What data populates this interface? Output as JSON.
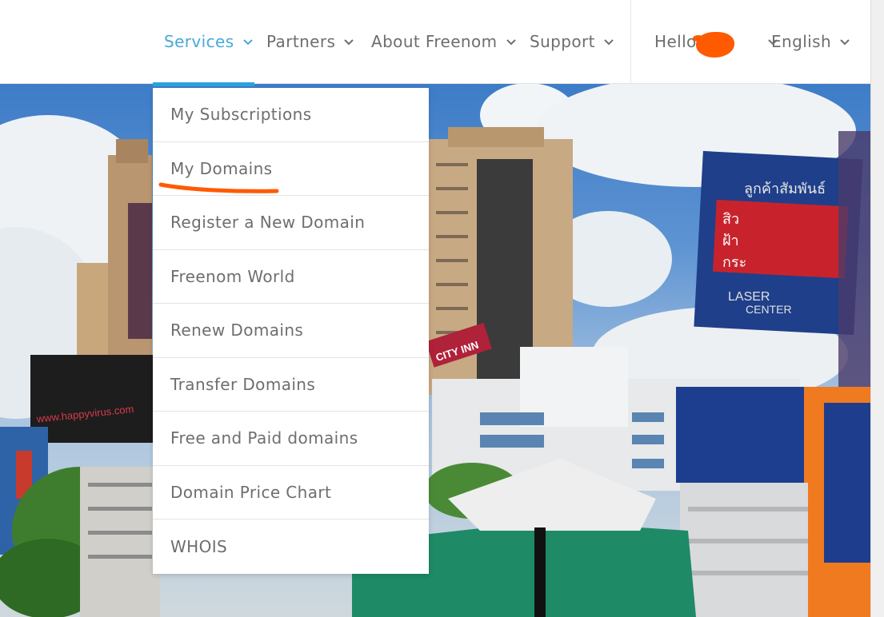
{
  "nav": {
    "services": "Services",
    "partners": "Partners",
    "about": "About Freenom",
    "support": "Support",
    "hello": "Hello",
    "language": "English"
  },
  "dropdown": {
    "items": [
      {
        "label": "My Subscriptions"
      },
      {
        "label": "My Domains"
      },
      {
        "label": "Register a New Domain"
      },
      {
        "label": "Freenom World"
      },
      {
        "label": "Renew Domains"
      },
      {
        "label": "Transfer Domains"
      },
      {
        "label": "Free and Paid domains"
      },
      {
        "label": "Domain Price Chart"
      },
      {
        "label": "WHOIS"
      }
    ]
  },
  "hero": {
    "billboard_thai_top": "ลูกค้าสัมพันธ์",
    "billboard_thai_1": "สิว",
    "billboard_thai_2": "ฝ้า",
    "billboard_thai_3": "กระ",
    "billboard_laser": "LASER",
    "billboard_center": "CENTER",
    "billboard_left_web": "www.happyvirus.com",
    "sign_city": "CITY INN"
  },
  "colors": {
    "accent": "#2aa3dd",
    "nav_active": "#4aa8d8",
    "nav_text": "#6e6e6e",
    "annotation": "#ff5a00"
  },
  "icons": {
    "chevron": "chevron-down-icon"
  }
}
